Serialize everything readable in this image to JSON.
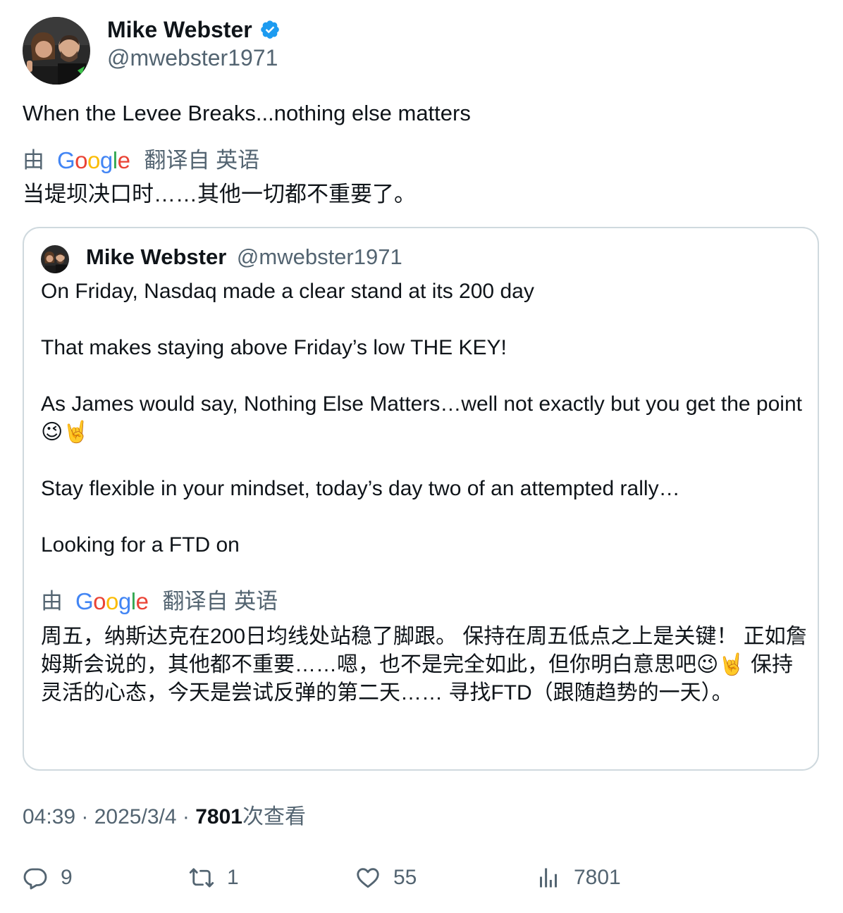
{
  "author": {
    "name": "Mike Webster",
    "handle": "@mwebster1971",
    "verified": true
  },
  "tweet": {
    "text": "When the Levee Breaks...nothing else matters",
    "translation": {
      "by_label": "由",
      "provider": "Google",
      "from_label": "翻译自 英语",
      "text": "当堤坝决口时……其他一切都不重要了。"
    }
  },
  "quoted": {
    "name": "Mike Webster",
    "handle": "@mwebster1971",
    "paragraphs": [
      "On Friday, Nasdaq made a clear stand at its 200 day",
      "That makes staying above Friday’s low THE KEY!",
      "As James would say, Nothing Else Matters…well not exactly but you get the point😉🤘",
      "Stay flexible in your mindset, today’s day two of an attempted rally…",
      "Looking  for a FTD on"
    ],
    "translation": {
      "by_label": "由",
      "provider": "Google",
      "from_label": "翻译自 英语",
      "text": "周五，纳斯达克在200日均线处站稳了脚跟。 保持在周五低点之上是关键！ 正如詹姆斯会说的，其他都不重要……嗯，也不是完全如此，但你明白意思吧😉🤘 保持灵活的心态，今天是尝试反弹的第二天…… 寻找FTD（跟随趋势的一天）。"
    }
  },
  "meta": {
    "time": "04:39",
    "date": "2025/3/4",
    "views": "7801",
    "views_label": "次查看"
  },
  "actions": {
    "replies": "9",
    "reposts": "1",
    "likes": "55",
    "views": "7801"
  },
  "colors": {
    "text": "#0f1419",
    "secondary": "#536471",
    "verified": "#1d9bf0",
    "border": "#cfd9de"
  }
}
